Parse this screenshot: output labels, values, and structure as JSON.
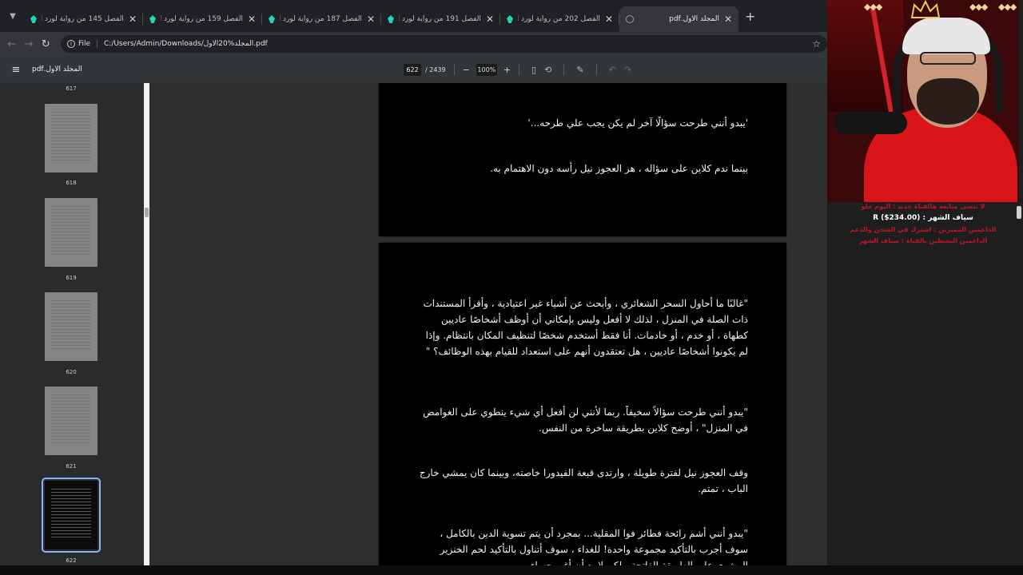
{
  "tabs": [
    {
      "title": "الفصل 145 من رواية لورد الغوا...",
      "active": false
    },
    {
      "title": "الفصل 159 من رواية لورد الغوا...",
      "active": false
    },
    {
      "title": "الفصل 187 من رواية لورد الغوا...",
      "active": false
    },
    {
      "title": "الفصل 191 من رواية لورد الغوا...",
      "active": false
    },
    {
      "title": "الفصل 202 من رواية لورد الغوا...",
      "active": false
    },
    {
      "title": "المجلد الاول.pdf",
      "active": true
    }
  ],
  "address": {
    "scheme": "File",
    "url": "C:/Users/Admin/Downloads/المجلد%20الاول.pdf"
  },
  "pdf": {
    "title": "المجلد الاول.pdf",
    "current_page": "622",
    "total_pages": "/ 2439",
    "zoom": "100%"
  },
  "thumbnails": [
    {
      "label": "617"
    },
    {
      "label": "618"
    },
    {
      "label": "619"
    },
    {
      "label": "620"
    },
    {
      "label": "621"
    },
    {
      "label": "622"
    }
  ],
  "page_top": {
    "paragraphs": [
      "'يبدو أنني طرحت سؤالًا آخر لم يكن يجب علي طرحه...'",
      "بينما ندم كلاين على سؤاله ، هز العجوز نيل رأسه دون الاهتمام به."
    ]
  },
  "page_main": {
    "paragraphs": [
      "\"غالبًا ما أحاول السحر الشعائري ، وأبحث عن أشياء غير اعتيادية ، وأقرأ المستندات ذات الصلة في المنزل ، لذلك لا أفعل وليس بإمكاني أن أوظف أشخاصًا عاديين كطهاة ، أو خدم ، أو خادمات. أنا فقط أستخدم شخصًا لتنظيف المكان بانتظام. وإذا لم يكونوا أشخاصًا عاديين ، هل تعتقدون أنهم على استعداد للقيام بهذه الوظائف؟ \"",
      "\"يبدو أنني طرحت سؤالاً سخيفاً. ربما لأنني لن أفعل أي شيء ينطوي على الغوامض في المنزل\" ، أوضح كلاين بطريقة ساخرة من النفس.",
      "وقف العجوز نيل لفترة طويلة ، وارتدى قبعة الفيدورا خاصته، وبينما كان يمشي خارج الباب ، تمتم.",
      "\"يبدو أنني أشم رائحة فطائر فوا المقلية... بمجرد أن يتم تسوية الدين بالكامل ، سوف أجرب بالتأكيد مجموعة واحدة! للغداء ، سوف أتناول بالتأكيد لحم الخنزير المشوي على الطريقة الفاتحة ، لكن لا بد أن أغير حساء..."
    ]
  },
  "stream": {
    "lines": [
      {
        "text": "لا تنسى متابعة هالقناة جديد : اليوم حلو",
        "style": "red"
      },
      {
        "text": "سياف الشهر : R ($234.00)",
        "style": "white"
      },
      {
        "text": "الداعمين المميزين : اشترك في الشحن والدعم",
        "style": "red"
      },
      {
        "text": "الداعمين النشطين بالقناة : سياف الشهر",
        "style": "red"
      }
    ]
  }
}
